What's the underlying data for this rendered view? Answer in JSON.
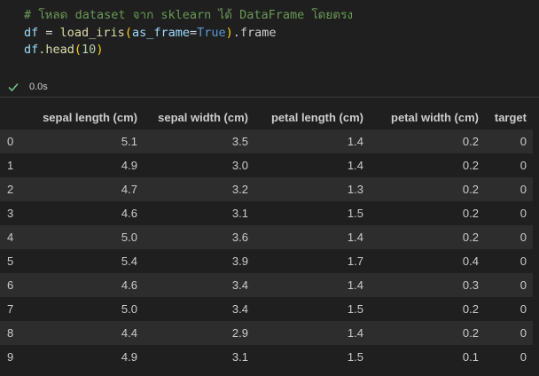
{
  "code_cell": {
    "line1_comment": "# โหลด dataset จาก sklearn ได้ DataFrame โดยตรง",
    "line2": {
      "var": "df",
      "op": " = ",
      "fn": "load_iris",
      "paren_open": "(",
      "arg_name": "as_frame",
      "eq": "=",
      "arg_value": "True",
      "paren_close": ")",
      "attr": ".frame"
    },
    "line3": {
      "var": "df",
      "method": ".head",
      "paren_open": "(",
      "num": "10",
      "paren_close": ")"
    }
  },
  "status": {
    "icon": "check-icon",
    "exec_time": "0.0s",
    "success_color": "#73c991"
  },
  "table": {
    "columns": [
      "",
      "sepal length (cm)",
      "sepal width (cm)",
      "petal length (cm)",
      "petal width (cm)",
      "target"
    ],
    "rows": [
      [
        "0",
        "5.1",
        "3.5",
        "1.4",
        "0.2",
        "0"
      ],
      [
        "1",
        "4.9",
        "3.0",
        "1.4",
        "0.2",
        "0"
      ],
      [
        "2",
        "4.7",
        "3.2",
        "1.3",
        "0.2",
        "0"
      ],
      [
        "3",
        "4.6",
        "3.1",
        "1.5",
        "0.2",
        "0"
      ],
      [
        "4",
        "5.0",
        "3.6",
        "1.4",
        "0.2",
        "0"
      ],
      [
        "5",
        "5.4",
        "3.9",
        "1.7",
        "0.4",
        "0"
      ],
      [
        "6",
        "4.6",
        "3.4",
        "1.4",
        "0.3",
        "0"
      ],
      [
        "7",
        "5.0",
        "3.4",
        "1.5",
        "0.2",
        "0"
      ],
      [
        "8",
        "4.4",
        "2.9",
        "1.4",
        "0.2",
        "0"
      ],
      [
        "9",
        "4.9",
        "3.1",
        "1.5",
        "0.1",
        "0"
      ]
    ]
  }
}
